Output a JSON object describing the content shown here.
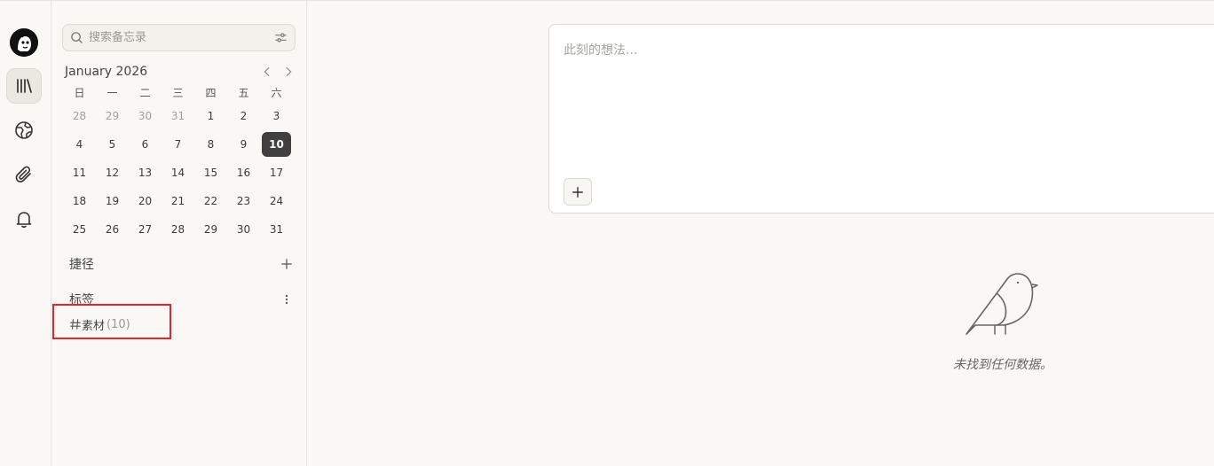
{
  "search": {
    "placeholder": "搜索备忘录"
  },
  "calendar": {
    "title": "January 2026",
    "weekdays": [
      "日",
      "一",
      "二",
      "三",
      "四",
      "五",
      "六"
    ],
    "days": [
      {
        "d": "28",
        "m": true
      },
      {
        "d": "29",
        "m": true
      },
      {
        "d": "30",
        "m": true
      },
      {
        "d": "31",
        "m": true
      },
      {
        "d": "1"
      },
      {
        "d": "2"
      },
      {
        "d": "3"
      },
      {
        "d": "4"
      },
      {
        "d": "5"
      },
      {
        "d": "6"
      },
      {
        "d": "7"
      },
      {
        "d": "8"
      },
      {
        "d": "9"
      },
      {
        "d": "10",
        "today": true
      },
      {
        "d": "11"
      },
      {
        "d": "12"
      },
      {
        "d": "13"
      },
      {
        "d": "14"
      },
      {
        "d": "15"
      },
      {
        "d": "16"
      },
      {
        "d": "17"
      },
      {
        "d": "18"
      },
      {
        "d": "19"
      },
      {
        "d": "20"
      },
      {
        "d": "21"
      },
      {
        "d": "22"
      },
      {
        "d": "23"
      },
      {
        "d": "24"
      },
      {
        "d": "25"
      },
      {
        "d": "26"
      },
      {
        "d": "27"
      },
      {
        "d": "28"
      },
      {
        "d": "29"
      },
      {
        "d": "30"
      },
      {
        "d": "31"
      }
    ]
  },
  "shortcuts": {
    "label": "捷径"
  },
  "tags": {
    "label": "标签",
    "items": [
      {
        "name": "素材",
        "count": "(10)"
      }
    ]
  },
  "editor": {
    "placeholder": "此刻的想法..."
  },
  "empty": {
    "text": "未找到任何数据。"
  }
}
